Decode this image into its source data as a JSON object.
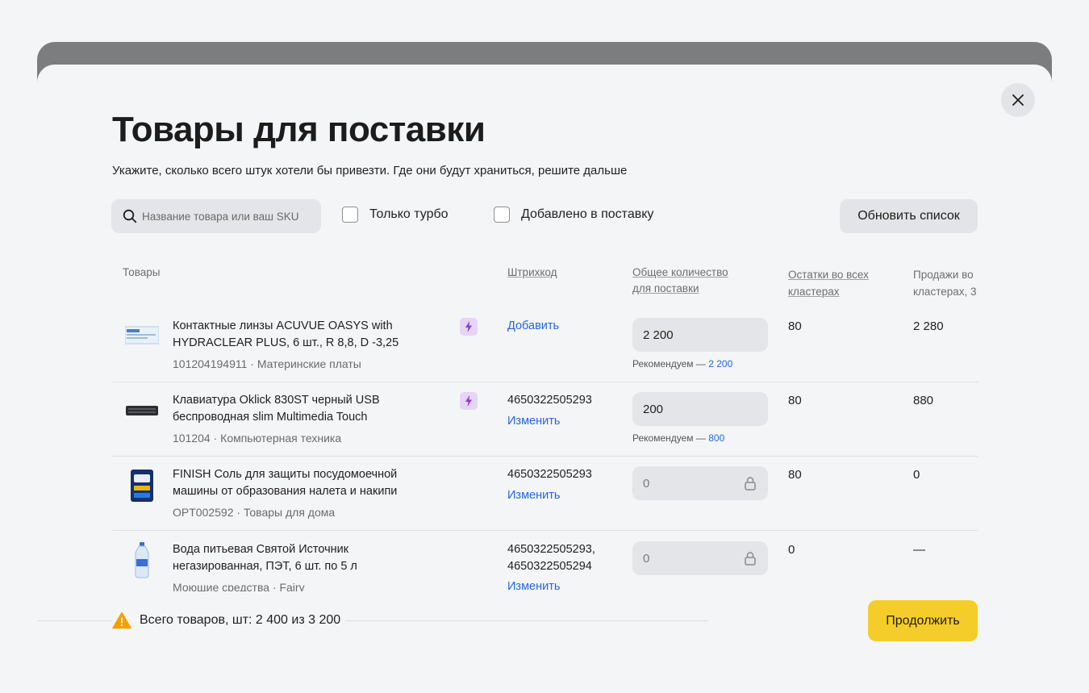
{
  "modal": {
    "title": "Товары для поставки",
    "subtitle": "Укажите, сколько всего штук хотели бы привезти. Где они будут храниться, решите дальше"
  },
  "filters": {
    "search_placeholder": "Название товара или ваш SKU",
    "turbo_only_label": "Только турбо",
    "added_label": "Добавлено в поставку",
    "refresh_label": "Обновить список"
  },
  "table": {
    "headers": {
      "products": "Товары",
      "barcode": "Штрихкод",
      "quantity_line1": "Общее количество",
      "quantity_line2": "для поставки",
      "stock_line1": "Остатки во всех",
      "stock_line2": "кластерах",
      "sales_line1": "Продажи во",
      "sales_line2": "кластерах, 3"
    },
    "rows": [
      {
        "name_line1": "Контактные линзы ACUVUE OASYS with",
        "name_line2": "HYDRACLEAR PLUS, 6 шт., R 8,8, D -3,25",
        "sku": "101204194911 · Материнские платы",
        "barcode_action": "Добавить",
        "qty": "2 200",
        "rec_prefix": "Рекомендуем — ",
        "rec_value": "2 200",
        "stock": "80",
        "sales": "2 280"
      },
      {
        "name_line1": "Клавиатура Oklick 830ST черный USB",
        "name_line2": "беспроводная slim Multimedia Touch",
        "sku": "101204 · Компьютерная техника",
        "barcode": "4650322505293",
        "barcode_action": "Изменить",
        "qty": "200",
        "rec_prefix": "Рекомендуем — ",
        "rec_value": "800",
        "stock": "80",
        "sales": "880"
      },
      {
        "name_line1": "FINISH Соль для защиты посудомоечной",
        "name_line2": "машины от образования налета и накипи",
        "sku": "OPT002592 · Товары для дома",
        "barcode": "4650322505293",
        "barcode_action": "Изменить",
        "qty": "0",
        "stock": "80",
        "sales": "0"
      },
      {
        "name_line1": "Вода питьевая Святой Источник",
        "name_line2": "негазированная, ПЭТ, 6 шт. по 5 л",
        "sku": "Моющие средства · Fairy",
        "barcode": "4650322505293,",
        "barcode2": "4650322505294",
        "barcode_action": "Изменить",
        "qty": "0",
        "stock": "0",
        "sales": "—"
      }
    ]
  },
  "footer": {
    "total_label": "Всего товаров, шт: 2 400 из 3 200",
    "continue_label": "Продолжить"
  },
  "colors": {
    "accent_yellow": "#f5cd2a",
    "link_blue": "#2567e8",
    "turbo_purple": "#8a3ee0",
    "warning_orange": "#f5a000"
  }
}
